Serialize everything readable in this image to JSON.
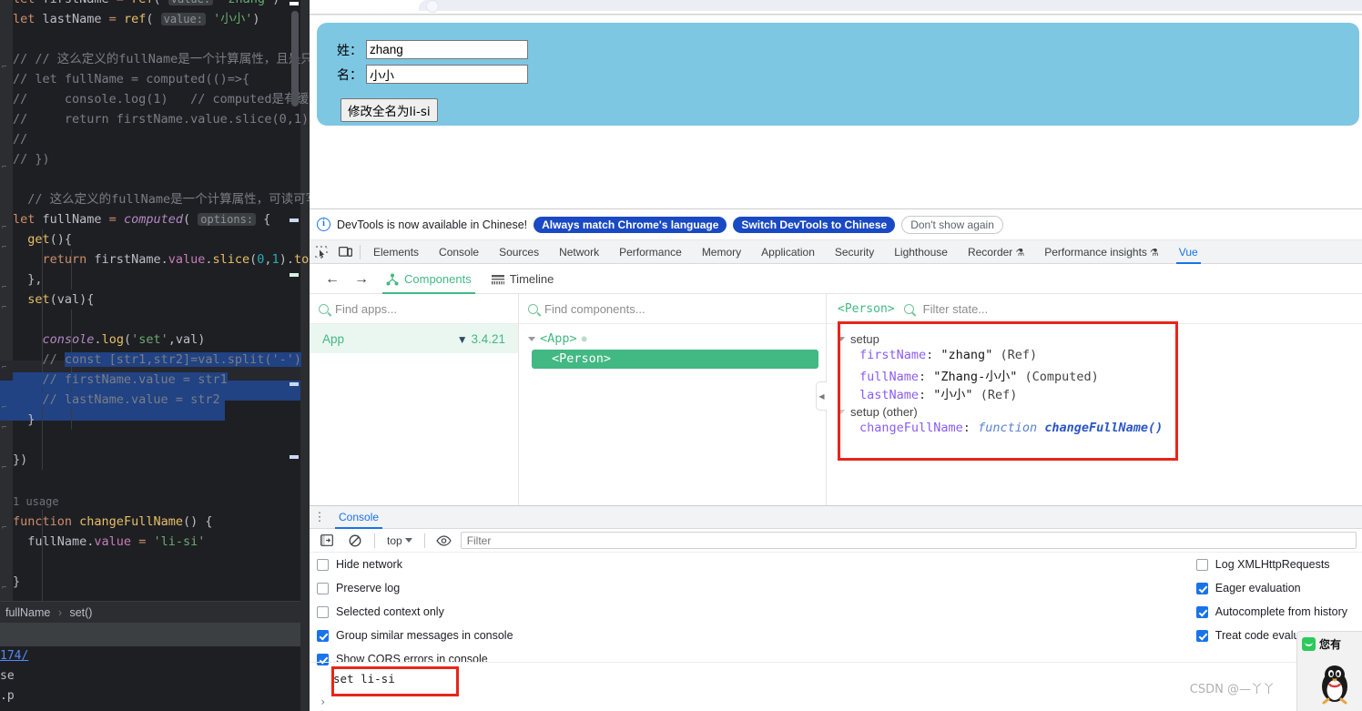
{
  "ide": {
    "code_lines": [
      "let firstName = ref( value: 'zhang')",
      "let lastName = ref( value: '小小')",
      "",
      "// // 这么定义的fullName是一个计算属性，且是只",
      "// let fullName = computed(()=>{",
      "//     console.log(1)   // computed是有缓",
      "//     return firstName.value.slice(0,1)",
      "//",
      "// })",
      "",
      "  // 这么定义的fullName是一个计算属性，可读可写",
      "let fullName = computed( options: {",
      "  get(){",
      "    return firstName.value.slice(0,1).to",
      "  },",
      "  set(val){",
      "",
      "    console.log('set',val)",
      "    // const [str1,str2]=val.split('-')",
      "    // firstName.value = str1",
      "    // lastName.value = str2",
      "  }",
      "",
      "})",
      "",
      "1 usage",
      "function changeFullName() {",
      "  fullName.value = 'li-si'",
      "",
      "}"
    ],
    "hint_value": "value:",
    "hint_options": "options:",
    "usage_label": "1 usage",
    "breadcrumb": {
      "item1": "fullName",
      "item2": "set()",
      "separator": "›"
    },
    "terminal": {
      "link": "174/",
      "line2": "se",
      "line3": ".p"
    }
  },
  "page": {
    "card": {
      "surname_label": "姓：",
      "surname_value": "zhang",
      "givenname_label": "名：",
      "givenname_value": "小小",
      "button_label": "修改全名为li-si",
      "bg_color": "#7ec7e3"
    }
  },
  "devtools": {
    "banner": {
      "message": "DevTools is now available in Chinese!",
      "btn_always": "Always match Chrome's language",
      "btn_switch": "Switch DevTools to Chinese",
      "btn_dismiss": "Don't show again",
      "accent": "#1a49c4"
    },
    "tabs": [
      {
        "label": "Elements",
        "active": false,
        "flask": false
      },
      {
        "label": "Console",
        "active": false,
        "flask": false
      },
      {
        "label": "Sources",
        "active": false,
        "flask": false
      },
      {
        "label": "Network",
        "active": false,
        "flask": false
      },
      {
        "label": "Performance",
        "active": false,
        "flask": false
      },
      {
        "label": "Memory",
        "active": false,
        "flask": false
      },
      {
        "label": "Application",
        "active": false,
        "flask": false
      },
      {
        "label": "Security",
        "active": false,
        "flask": false
      },
      {
        "label": "Lighthouse",
        "active": false,
        "flask": false
      },
      {
        "label": "Recorder",
        "active": false,
        "flask": true
      },
      {
        "label": "Performance insights",
        "active": false,
        "flask": true
      },
      {
        "label": "Vue",
        "active": true,
        "flask": false
      }
    ],
    "flask_glyph": "⚗",
    "active_tab_color": "#1a73e8"
  },
  "vue": {
    "nav_back": "←",
    "nav_forward": "→",
    "tab_components": "Components",
    "tab_timeline": "Timeline",
    "accent": "#42b883",
    "apps": {
      "placeholder": "Find apps...",
      "name": "App",
      "version": "3.4.21",
      "logo": "▼"
    },
    "tree": {
      "placeholder": "Find components...",
      "root": "<App>",
      "selected": "<Person>"
    },
    "state": {
      "component": "<Person>",
      "placeholder": "Filter state...",
      "group_setup": "setup",
      "group_setup_other": "setup (other)",
      "items": [
        {
          "key": "firstName",
          "value": "\"zhang\"",
          "type": "(Ref)"
        },
        {
          "key": "fullName",
          "value": "\"Zhang-小小\"",
          "type": "(Computed)"
        },
        {
          "key": "lastName",
          "value": "\"小小\"",
          "type": "(Ref)"
        }
      ],
      "other_items": [
        {
          "key": "changeFullName",
          "kw": "function",
          "value": "changeFullName()"
        }
      ],
      "highlight_color": "#e8251a"
    }
  },
  "console": {
    "tab_label": "Console",
    "context": "top",
    "filter_placeholder": "Filter",
    "settings_left": [
      {
        "label": "Hide network",
        "checked": false
      },
      {
        "label": "Preserve log",
        "checked": false
      },
      {
        "label": "Selected context only",
        "checked": false
      },
      {
        "label": "Group similar messages in console",
        "checked": true
      },
      {
        "label": "Show CORS errors in console",
        "checked": true
      }
    ],
    "settings_right": [
      {
        "label": "Log XMLHttpRequests",
        "checked": false
      },
      {
        "label": "Eager evaluation",
        "checked": true
      },
      {
        "label": "Autocomplete from history",
        "checked": true
      },
      {
        "label": "Treat code evaluat",
        "checked": true
      }
    ],
    "output_message": "set li-si",
    "prompt": "›",
    "highlight_color": "#e8251a"
  },
  "overlay": {
    "qq_text": "您有",
    "watermark": "CSDN @—丫丫"
  }
}
